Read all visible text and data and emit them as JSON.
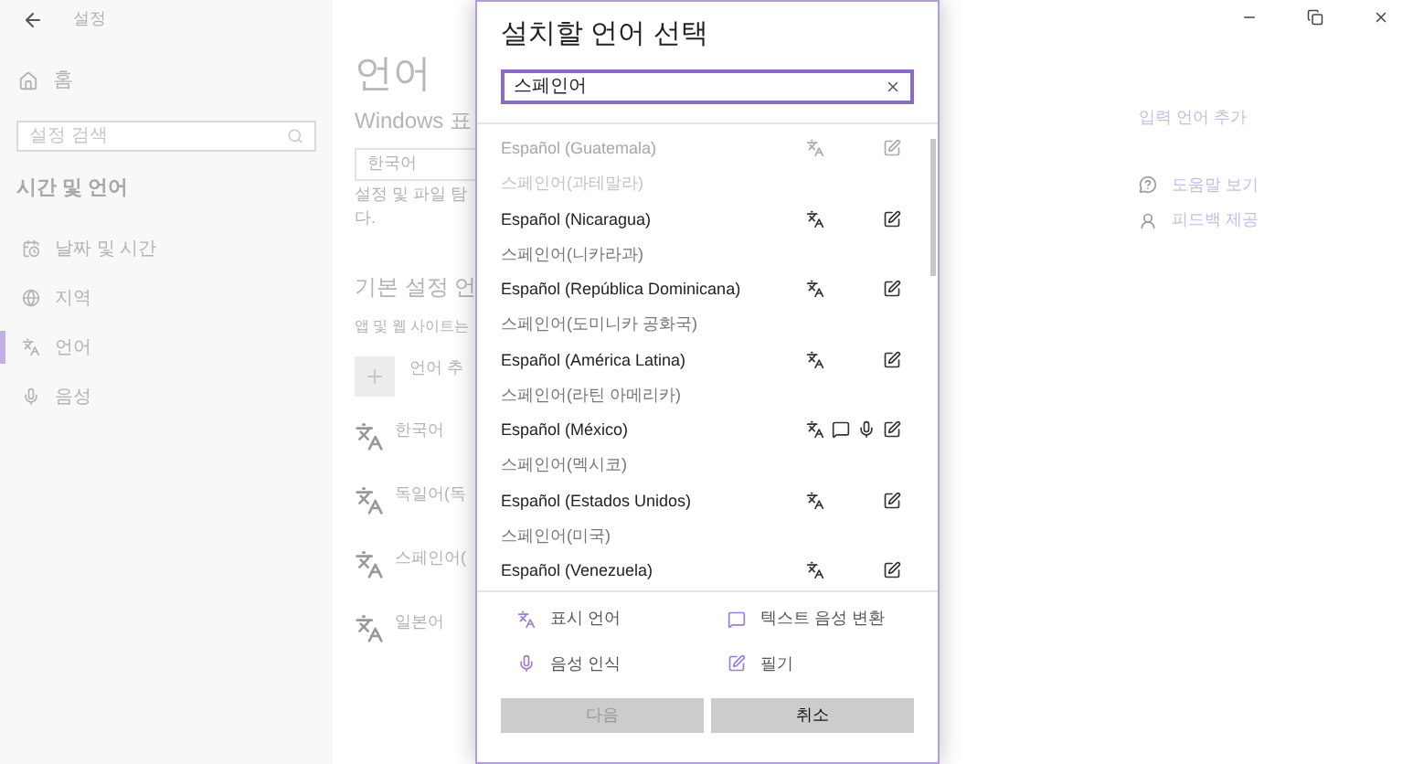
{
  "window": {
    "title": "설정"
  },
  "nav": {
    "home": "홈",
    "search_placeholder": "설정 검색",
    "section": "시간 및 언어",
    "items": [
      {
        "label": "날짜 및 시간",
        "selected": false
      },
      {
        "label": "지역",
        "selected": false
      },
      {
        "label": "언어",
        "selected": true
      },
      {
        "label": "음성",
        "selected": false
      }
    ]
  },
  "main": {
    "heading": "언어",
    "subheading": "Windows 표",
    "display_language": "한국어",
    "description": [
      "설정 및 파일 탐",
      "다."
    ],
    "preferred_heading": "기본 설정 언",
    "preferred_note": "앱 및 웹 사이트는",
    "add_language": "언어 추",
    "languages": [
      "한국어",
      "독일어(독",
      "스페인어(",
      "일본어"
    ]
  },
  "side_links": {
    "add_input": "입력 언어 추가",
    "help": "도움말 보기",
    "feedback": "피드백 제공"
  },
  "dialog": {
    "title": "설치할 언어 선택",
    "search_value": "스페인어",
    "results": [
      {
        "name": "Español (Guatemala)",
        "native": "스페인어(과테말라)",
        "dimmed": true,
        "display": true,
        "tts": false,
        "speech": false,
        "handwriting": true
      },
      {
        "name": "Español (Nicaragua)",
        "native": "스페인어(니카라과)",
        "dimmed": false,
        "display": true,
        "tts": false,
        "speech": false,
        "handwriting": true
      },
      {
        "name": "Español (República Dominicana)",
        "native": "스페인어(도미니카 공화국)",
        "dimmed": false,
        "display": true,
        "tts": false,
        "speech": false,
        "handwriting": true
      },
      {
        "name": "Español (América Latina)",
        "native": "스페인어(라틴 아메리카)",
        "dimmed": false,
        "display": true,
        "tts": false,
        "speech": false,
        "handwriting": true
      },
      {
        "name": "Español (México)",
        "native": "스페인어(멕시코)",
        "dimmed": false,
        "display": true,
        "tts": true,
        "speech": true,
        "handwriting": true
      },
      {
        "name": "Español (Estados Unidos)",
        "native": "스페인어(미국)",
        "dimmed": false,
        "display": true,
        "tts": false,
        "speech": false,
        "handwriting": true
      },
      {
        "name": "Español (Venezuela)",
        "dimmed": false,
        "display": true,
        "tts": false,
        "speech": false,
        "handwriting": true
      }
    ],
    "legend": [
      {
        "kind": "display",
        "label": "표시 언어"
      },
      {
        "kind": "tts",
        "label": "텍스트 음성 변환"
      },
      {
        "kind": "speech",
        "label": "음성 인식"
      },
      {
        "kind": "handwriting",
        "label": "필기"
      }
    ],
    "buttons": [
      {
        "label": "다음",
        "disabled": true
      },
      {
        "label": "취소",
        "disabled": false
      }
    ]
  }
}
